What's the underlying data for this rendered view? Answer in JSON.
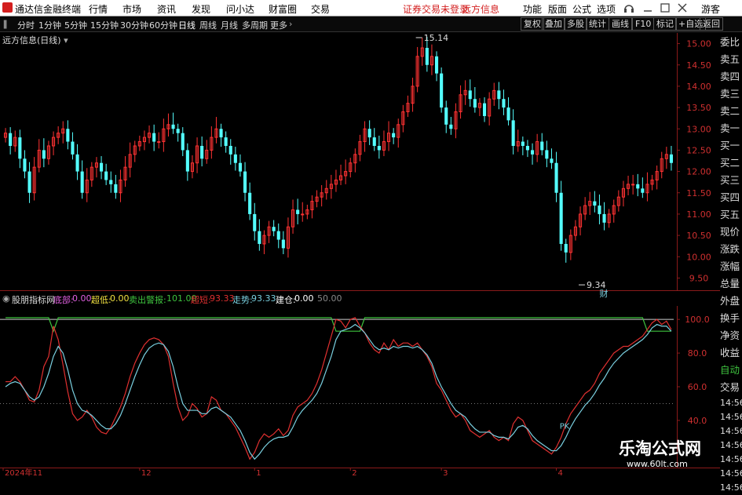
{
  "titlebar": {
    "app": "通达信金融终端",
    "menu": [
      "行情",
      "市场",
      "资讯",
      "发现",
      "问小达",
      "财富圈",
      "交易"
    ],
    "notice": "证券交易未登录",
    "stock": "远方信息",
    "right_menu": [
      "功能",
      "版面",
      "公式",
      "选项"
    ],
    "user": "游客"
  },
  "toolbar": {
    "periods": [
      "分时",
      "1分钟",
      "5分钟",
      "15分钟",
      "30分钟",
      "60分钟",
      "日线",
      "周线",
      "月线",
      "多周期",
      "更多"
    ],
    "selected": "日线",
    "buttons": [
      "复权",
      "叠加",
      "多股",
      "统计",
      "画线",
      "F10",
      "标记",
      "+自选",
      "返回"
    ]
  },
  "chart_title": "远方信息(日线)",
  "sidebar": [
    "委比",
    "卖五",
    "卖四",
    "卖三",
    "卖二",
    "卖一",
    "买一",
    "买二",
    "买三",
    "买四",
    "买五",
    "现价",
    "涨跌",
    "涨幅",
    "总量",
    "外盘",
    "换手",
    "净资",
    "收益",
    "自动",
    "交易",
    "14:56",
    "14:56",
    "14:56",
    "14:56",
    "14:56",
    "14:56",
    "14:56"
  ],
  "indicator_bar": {
    "name": "股朋指标网",
    "items": [
      {
        "label": "底部:",
        "value": "0.00",
        "color": "#e060e0"
      },
      {
        "label": "超低:",
        "value": "0.00",
        "color": "#f0e040"
      },
      {
        "label": "卖出警报:",
        "value": "101.00",
        "color": "#3ec33e"
      },
      {
        "label": "超短:",
        "value": "93.33",
        "color": "#e03030"
      },
      {
        "label": "走势:",
        "value": "93.33",
        "color": "#7ad0e0"
      },
      {
        "label": "建仓:",
        "value": "0.00",
        "color": "#ffffff"
      },
      {
        "label": "",
        "value": "50.00",
        "color": "#888888"
      }
    ]
  },
  "watermark": {
    "title": "乐淘公式网",
    "url": "www.60lt.com"
  },
  "chart_data": [
    {
      "type": "candlestick",
      "ylim": [
        9.25,
        15.25
      ],
      "yticks": [
        15.0,
        14.5,
        14.0,
        13.5,
        13.0,
        12.5,
        12.0,
        11.5,
        11.0,
        10.5,
        10.0,
        9.5
      ],
      "x_labels": [
        {
          "text": "2024年11",
          "index": 0
        },
        {
          "text": "12",
          "index": 28
        },
        {
          "text": "1",
          "index": 52
        },
        {
          "text": "2",
          "index": 72
        },
        {
          "text": "3",
          "index": 91
        },
        {
          "text": "4",
          "index": 115
        }
      ],
      "annotations": [
        {
          "text": "15.14",
          "index": 86,
          "value": 15.14
        },
        {
          "text": "9.34",
          "index": 120,
          "value": 9.34
        },
        {
          "text": "财",
          "index": 124,
          "value": 9.34
        }
      ],
      "closes": [
        12.9,
        12.6,
        12.8,
        12.3,
        12.0,
        11.5,
        12.1,
        12.5,
        12.3,
        12.6,
        12.8,
        12.9,
        13.0,
        12.7,
        12.4,
        12.0,
        11.5,
        11.8,
        12.1,
        12.2,
        12.0,
        11.8,
        11.7,
        11.5,
        11.8,
        12.1,
        12.4,
        12.6,
        12.7,
        12.8,
        12.9,
        12.7,
        12.7,
        13.0,
        13.1,
        13.0,
        12.9,
        12.5,
        12.0,
        12.2,
        12.6,
        12.3,
        12.5,
        12.8,
        13.0,
        12.8,
        12.6,
        12.4,
        12.2,
        12.0,
        11.5,
        11.0,
        10.6,
        10.3,
        10.5,
        10.7,
        10.6,
        10.4,
        10.2,
        10.7,
        11.1,
        11.0,
        11.0,
        11.1,
        11.3,
        11.4,
        11.5,
        11.6,
        11.7,
        11.8,
        11.9,
        12.0,
        12.2,
        12.4,
        12.7,
        13.0,
        12.8,
        12.6,
        12.5,
        12.7,
        12.9,
        12.8,
        13.1,
        13.4,
        13.6,
        14.0,
        14.7,
        14.9,
        14.5,
        14.7,
        14.3,
        13.5,
        13.1,
        13.0,
        13.4,
        13.8,
        13.9,
        13.7,
        13.5,
        13.6,
        13.3,
        13.7,
        13.9,
        13.7,
        13.5,
        13.2,
        12.6,
        12.7,
        12.6,
        12.5,
        12.4,
        12.7,
        12.5,
        12.3,
        12.2,
        11.5,
        10.3,
        10.1,
        10.5,
        10.7,
        11.0,
        11.2,
        11.3,
        11.2,
        11.0,
        10.8,
        11.0,
        11.2,
        11.4,
        11.6,
        11.7,
        11.7,
        11.6,
        11.5,
        11.7,
        11.8,
        12.0,
        12.3,
        12.4,
        12.2
      ]
    },
    {
      "type": "line",
      "ylim": [
        12,
        108
      ],
      "yticks": [
        100.0,
        80.0,
        60.0,
        40.0
      ],
      "series": [
        {
          "name": "超短",
          "color": "#e03030",
          "values": [
            63,
            63,
            66,
            63,
            58,
            52,
            51,
            58,
            72,
            78,
            96,
            88,
            73,
            57,
            44,
            40,
            42,
            46,
            42,
            36,
            33,
            32,
            36,
            42,
            48,
            56,
            66,
            74,
            80,
            85,
            88,
            89,
            88,
            85,
            78,
            62,
            48,
            40,
            43,
            50,
            47,
            42,
            44,
            54,
            52,
            46,
            44,
            40,
            36,
            30,
            24,
            17,
            21,
            28,
            32,
            30,
            32,
            35,
            31,
            34,
            43,
            48,
            50,
            52,
            56,
            62,
            70,
            80,
            90,
            100,
            99,
            95,
            100,
            101,
            96,
            92,
            86,
            82,
            80,
            86,
            82,
            88,
            84,
            86,
            86,
            84,
            86,
            82,
            78,
            72,
            62,
            58,
            52,
            46,
            42,
            44,
            40,
            34,
            32,
            30,
            32,
            34,
            30,
            28,
            30,
            28,
            38,
            42,
            40,
            34,
            28,
            26,
            24,
            22,
            20,
            24,
            30,
            38,
            44,
            48,
            52,
            56,
            58,
            62,
            68,
            72,
            76,
            80,
            82,
            84,
            84,
            86,
            88,
            90,
            94,
            98,
            100,
            97,
            99,
            94
          ]
        },
        {
          "name": "走势",
          "color": "#7ad0e0",
          "values": [
            60,
            62,
            63,
            62,
            58,
            54,
            52,
            54,
            60,
            68,
            78,
            84,
            80,
            70,
            58,
            50,
            46,
            45,
            43,
            40,
            37,
            35,
            35,
            38,
            43,
            50,
            58,
            66,
            73,
            79,
            83,
            85,
            86,
            85,
            81,
            72,
            60,
            50,
            46,
            46,
            46,
            44,
            44,
            47,
            48,
            46,
            44,
            42,
            38,
            34,
            28,
            21,
            17,
            20,
            24,
            27,
            29,
            30,
            30,
            31,
            36,
            42,
            46,
            49,
            52,
            56,
            62,
            70,
            78,
            88,
            93,
            94,
            95,
            97,
            95,
            92,
            88,
            84,
            82,
            83,
            82,
            84,
            83,
            84,
            84,
            83,
            84,
            82,
            79,
            74,
            66,
            60,
            55,
            50,
            46,
            44,
            42,
            38,
            35,
            33,
            33,
            33,
            31,
            30,
            30,
            29,
            32,
            36,
            37,
            35,
            31,
            28,
            26,
            24,
            22,
            22,
            25,
            30,
            36,
            41,
            45,
            49,
            52,
            56,
            61,
            65,
            70,
            74,
            77,
            80,
            82,
            84,
            86,
            88,
            91,
            95,
            97,
            96,
            96,
            93
          ]
        },
        {
          "name": "卖出警报",
          "color": "#3ec33e"
        }
      ],
      "annotations": [
        {
          "text": "PK",
          "index": 117,
          "value": 35
        }
      ]
    }
  ]
}
